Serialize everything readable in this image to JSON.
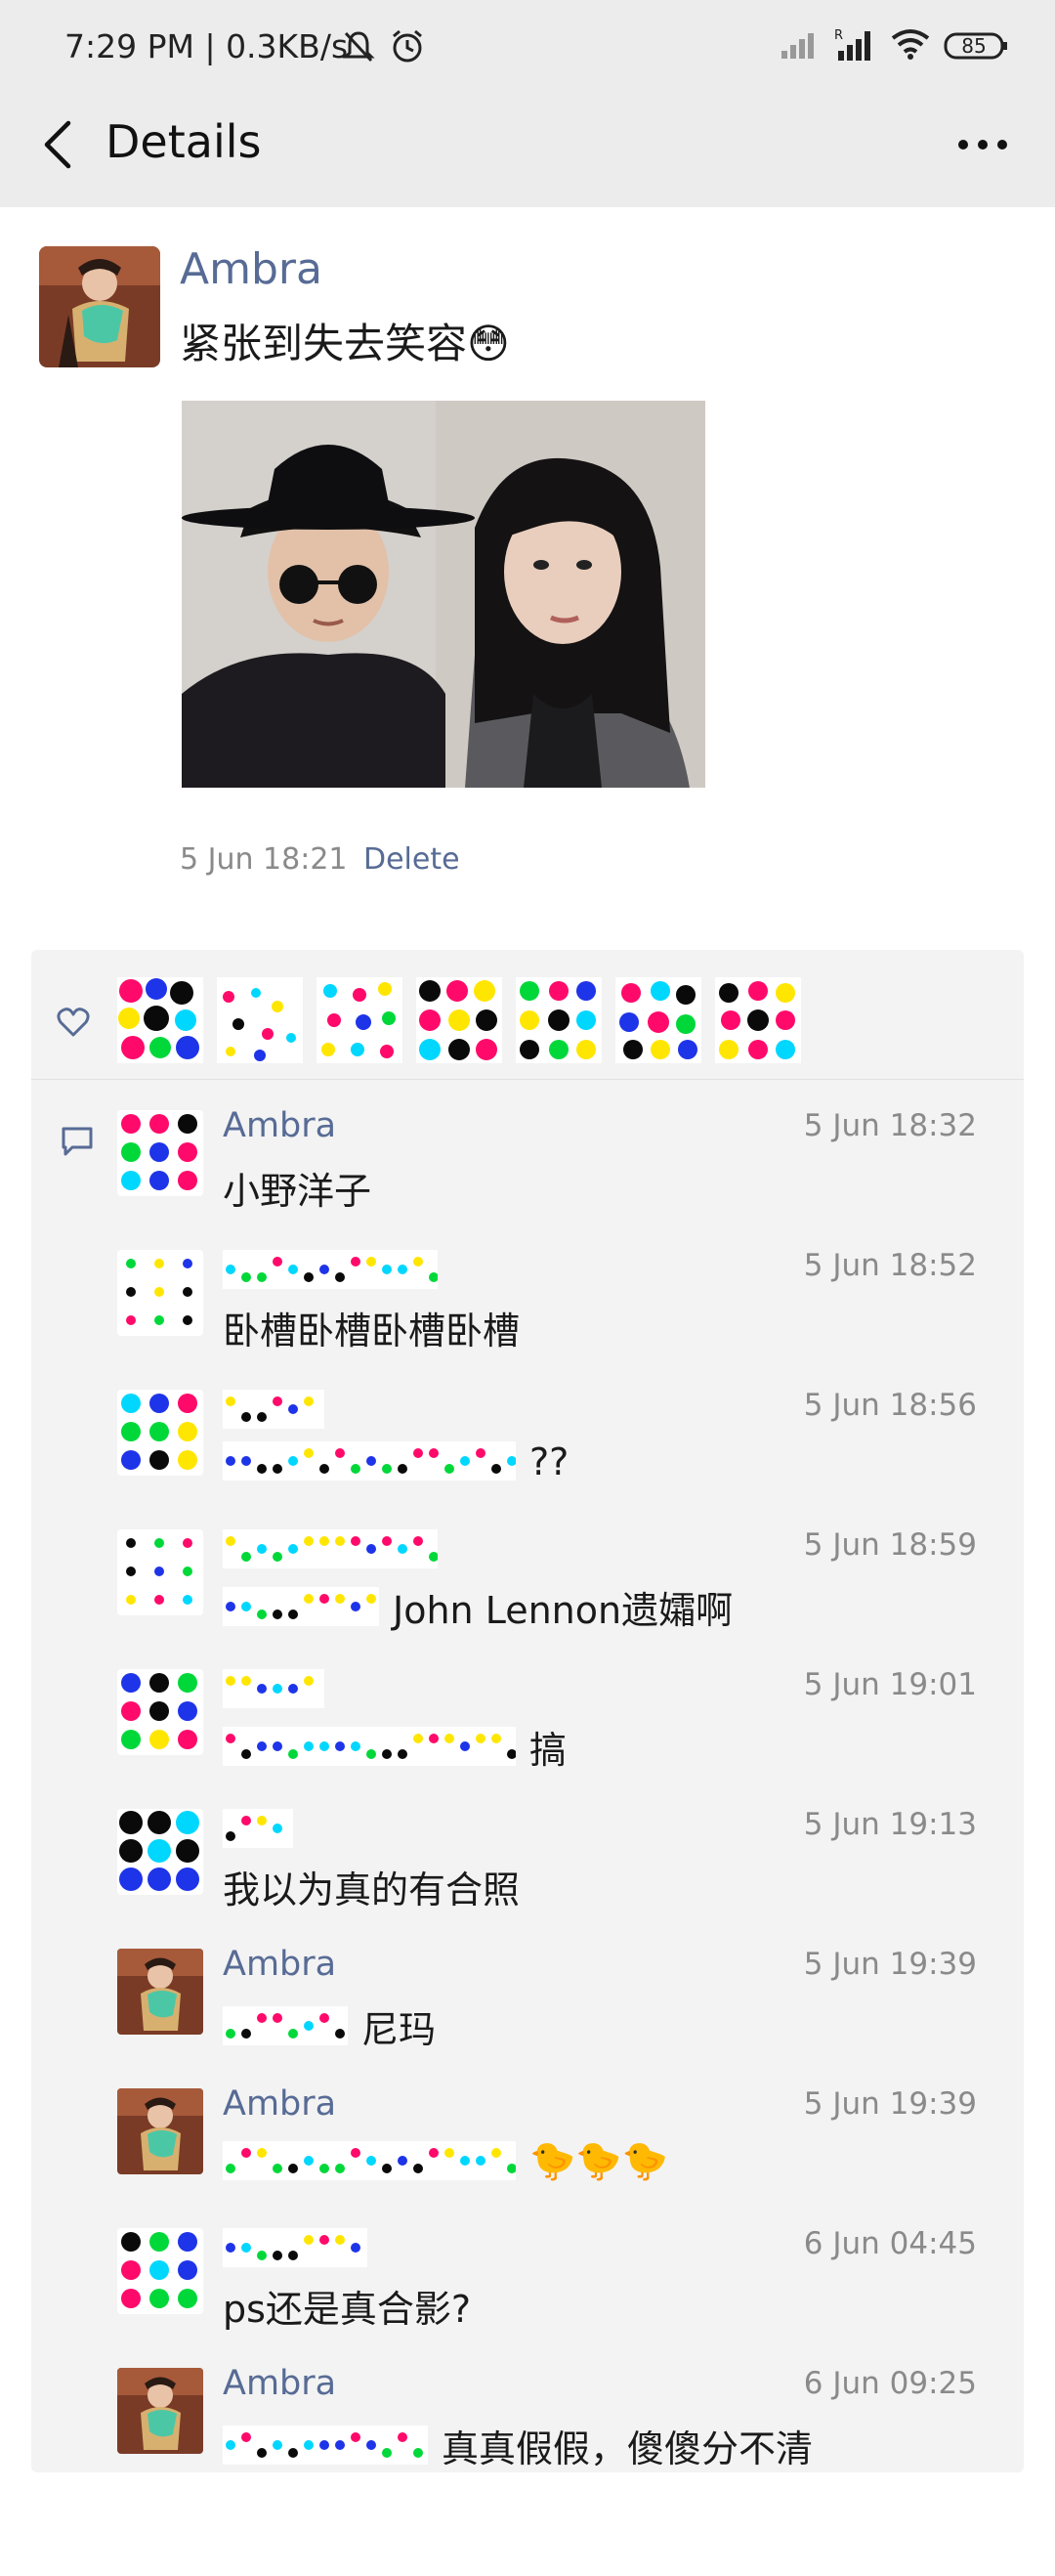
{
  "status": {
    "time": "7:29 PM | 0.3KB/s",
    "battery": "85"
  },
  "header": {
    "title": "Details"
  },
  "post": {
    "user": "Ambra",
    "text": "紧张到失去笑容😳",
    "time": "5 Jun 18:21",
    "delete_label": "Delete"
  },
  "likes": {
    "count_visible": 7
  },
  "comments": [
    {
      "name": "Ambra",
      "time": "5 Jun 18:32",
      "text": "小野洋子",
      "avatar": "pixel"
    },
    {
      "name": "",
      "time": "5 Jun 18:52",
      "text": "卧槽卧槽卧槽卧槽",
      "avatar": "pixel-light"
    },
    {
      "name": "",
      "time": "5 Jun 18:56",
      "text": "??",
      "avatar": "pixel"
    },
    {
      "name": "",
      "time": "5 Jun 18:59",
      "text": "John Lennon遗孀啊",
      "avatar": "pixel-light"
    },
    {
      "name": "",
      "time": "5 Jun 19:01",
      "text": "搞",
      "avatar": "pixel"
    },
    {
      "name": "",
      "time": "5 Jun 19:13",
      "text": "我以为真的有合照",
      "avatar": "pixel-dark"
    },
    {
      "name": "Ambra",
      "time": "5 Jun 19:39",
      "text": "尼玛",
      "avatar": "photo"
    },
    {
      "name": "Ambra",
      "time": "5 Jun 19:39",
      "text": "🐤🐤🐤",
      "avatar": "photo"
    },
    {
      "name": "",
      "time": "6 Jun 04:45",
      "text": "ps还是真合影?",
      "avatar": "pixel"
    },
    {
      "name": "Ambra",
      "time": "6 Jun 09:25",
      "text": "真真假假，傻傻分不清",
      "avatar": "photo"
    }
  ],
  "colors": {
    "link": "#576b95",
    "header_bg": "#ececec",
    "panel_bg": "#f3f3f3"
  }
}
